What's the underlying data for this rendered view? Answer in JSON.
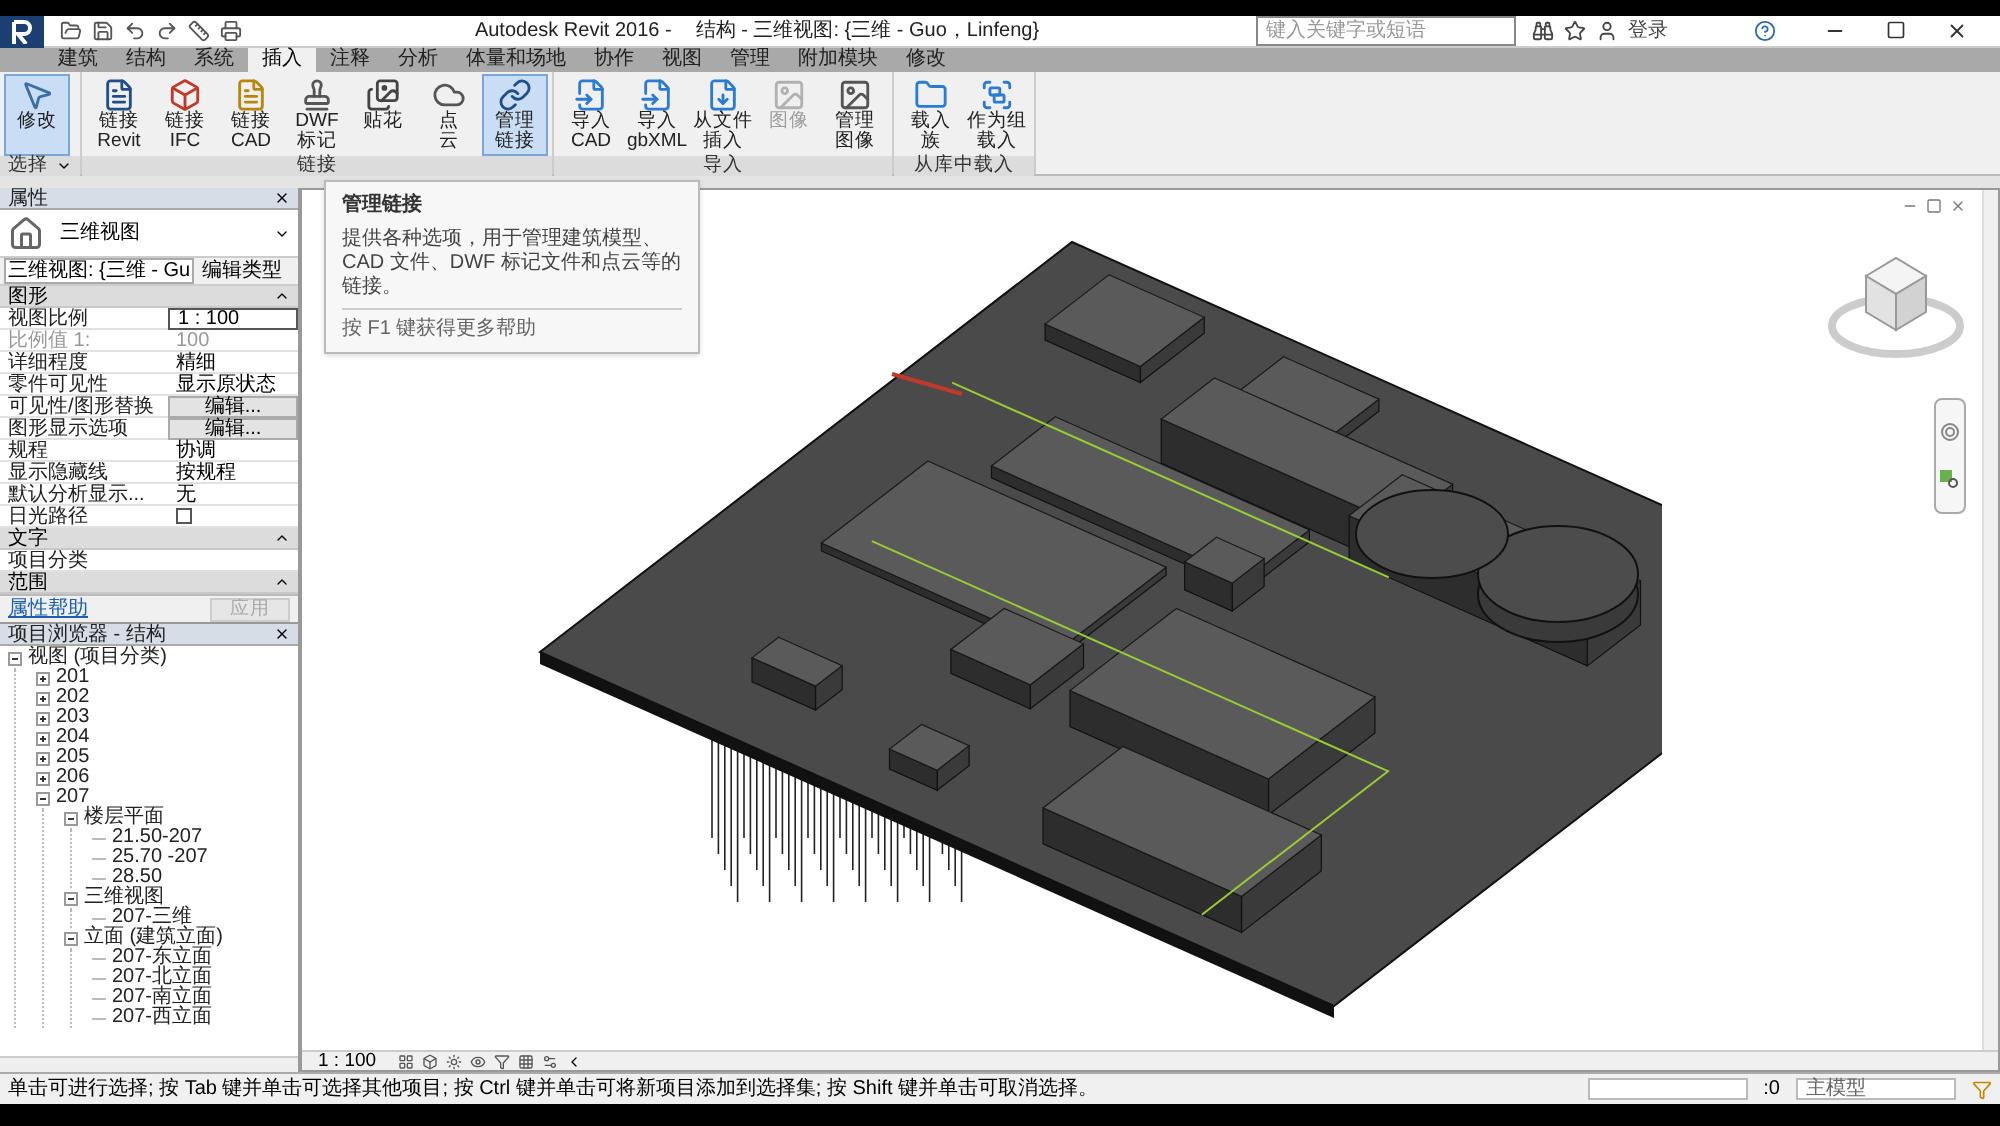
{
  "title_bar": {
    "app": "Autodesk Revit 2016 -",
    "document": "结构 - 三维视图: {三维 - Guo，Linfeng}",
    "search": {
      "placeholder": "键入关键字或短语"
    },
    "sign_in": "登录"
  },
  "tabs": [
    {
      "label": "建筑",
      "selected": false
    },
    {
      "label": "结构",
      "selected": false
    },
    {
      "label": "系统",
      "selected": false
    },
    {
      "label": "插入",
      "selected": true
    },
    {
      "label": "注释",
      "selected": false
    },
    {
      "label": "分析",
      "selected": false
    },
    {
      "label": "体量和场地",
      "selected": false
    },
    {
      "label": "协作",
      "selected": false
    },
    {
      "label": "视图",
      "selected": false
    },
    {
      "label": "管理",
      "selected": false
    },
    {
      "label": "附加模块",
      "selected": false
    },
    {
      "label": "修改",
      "selected": false
    }
  ],
  "ribbon": [
    {
      "label": "选择",
      "dropdown": true,
      "items": [
        {
          "kind": "pointer",
          "lines": [
            "修改"
          ],
          "selected": true,
          "disabled": false
        }
      ]
    },
    {
      "label": "链接",
      "dropdown": false,
      "items": [
        {
          "kind": "revit",
          "lines": [
            "链接",
            "Revit"
          ],
          "selected": false,
          "disabled": false
        },
        {
          "kind": "ifc",
          "lines": [
            "链接",
            "IFC"
          ],
          "selected": false,
          "disabled": false
        },
        {
          "kind": "cad",
          "lines": [
            "链接",
            "CAD"
          ],
          "selected": false,
          "disabled": false
        },
        {
          "kind": "dwf",
          "lines": [
            "DWF",
            "标记"
          ],
          "selected": false,
          "disabled": false
        },
        {
          "kind": "decal",
          "lines": [
            "贴花"
          ],
          "selected": false,
          "disabled": false
        },
        {
          "kind": "cloud",
          "lines": [
            "点",
            "云"
          ],
          "selected": false,
          "disabled": false
        },
        {
          "kind": "manage",
          "lines": [
            "管理",
            "链接"
          ],
          "selected": true,
          "disabled": false
        }
      ]
    },
    {
      "label": "导入",
      "dropdown": false,
      "items": [
        {
          "kind": "import",
          "lines": [
            "导入",
            "CAD"
          ],
          "selected": false,
          "disabled": false
        },
        {
          "kind": "import",
          "lines": [
            "导入",
            "gbXML"
          ],
          "selected": false,
          "disabled": false
        },
        {
          "kind": "file",
          "lines": [
            "从文件",
            "插入"
          ],
          "selected": false,
          "disabled": false
        },
        {
          "kind": "image",
          "lines": [
            "图像"
          ],
          "selected": false,
          "disabled": true
        },
        {
          "kind": "image",
          "lines": [
            "管理",
            "图像"
          ],
          "selected": false,
          "disabled": false
        }
      ]
    },
    {
      "label": "从库中载入",
      "dropdown": false,
      "items": [
        {
          "kind": "folder",
          "lines": [
            "载入",
            "族"
          ],
          "selected": false,
          "disabled": false
        },
        {
          "kind": "group",
          "lines": [
            "作为组",
            "载入"
          ],
          "selected": false,
          "disabled": false
        }
      ]
    }
  ],
  "tooltip": {
    "title": "管理链接",
    "body": "提供各种选项，用于管理建筑模型、CAD 文件、DWF 标记文件和点云等的链接。",
    "help": "按 F1 键获得更多帮助"
  },
  "properties": {
    "title": "属性",
    "type_name": "三维视图",
    "instance_selector": "三维视图: {三维 - Gu",
    "edit_type": "编辑类型",
    "sections": [
      {
        "title": "图形",
        "rows": [
          {
            "kind": "field",
            "label": "视图比例",
            "value": "1 : 100"
          },
          {
            "kind": "readonly",
            "label": "比例值 1:",
            "value": "100"
          },
          {
            "kind": "value",
            "label": "详细程度",
            "value": "精细"
          },
          {
            "kind": "value",
            "label": "零件可见性",
            "value": "显示原状态"
          },
          {
            "kind": "button",
            "label": "可见性/图形替换",
            "value": "编辑..."
          },
          {
            "kind": "button",
            "label": "图形显示选项",
            "value": "编辑..."
          },
          {
            "kind": "value",
            "label": "规程",
            "value": "协调"
          },
          {
            "kind": "value",
            "label": "显示隐藏线",
            "value": "按规程"
          },
          {
            "kind": "value",
            "label": "默认分析显示...",
            "value": "无"
          },
          {
            "kind": "checkbox",
            "label": "日光路径",
            "checked": false
          }
        ]
      },
      {
        "title": "文字",
        "rows": [
          {
            "kind": "value",
            "label": "项目分类",
            "value": ""
          }
        ]
      },
      {
        "title": "范围"
      }
    ],
    "help_link": "属性帮助",
    "apply": {
      "label": "应用",
      "disabled": true
    }
  },
  "project_browser": {
    "title": "项目浏览器 - 结构",
    "tree": [
      {
        "label": "视图 (项目分类)",
        "expanded": true,
        "children": [
          {
            "label": "201",
            "expanded": false
          },
          {
            "label": "202",
            "expanded": false
          },
          {
            "label": "203",
            "expanded": false
          },
          {
            "label": "204",
            "expanded": false
          },
          {
            "label": "205",
            "expanded": false
          },
          {
            "label": "206",
            "expanded": false
          },
          {
            "label": "207",
            "expanded": true,
            "children": [
              {
                "label": "楼层平面",
                "expanded": true,
                "children": [
                  {
                    "label": "21.50-207"
                  },
                  {
                    "label": "25.70 -207"
                  },
                  {
                    "label": "28.50"
                  }
                ]
              },
              {
                "label": "三维视图",
                "expanded": true,
                "children": [
                  {
                    "label": "207-三维"
                  }
                ]
              },
              {
                "label": "立面 (建筑立面)",
                "expanded": true,
                "children": [
                  {
                    "label": "207-东立面"
                  },
                  {
                    "label": "207-北立面"
                  },
                  {
                    "label": "207-南立面"
                  },
                  {
                    "label": "207-西立面"
                  }
                ]
              }
            ]
          }
        ]
      }
    ]
  },
  "view_bar": {
    "scale": "1 : 100"
  },
  "status_bar": {
    "message": "单击可进行选择; 按 Tab 键并单击可选择其他项目; 按 Ctrl 键并单击可将新项目添加到选择集; 按 Shift 键并单击可取消选择。",
    "selection_count": ":0",
    "model": "主模型"
  }
}
